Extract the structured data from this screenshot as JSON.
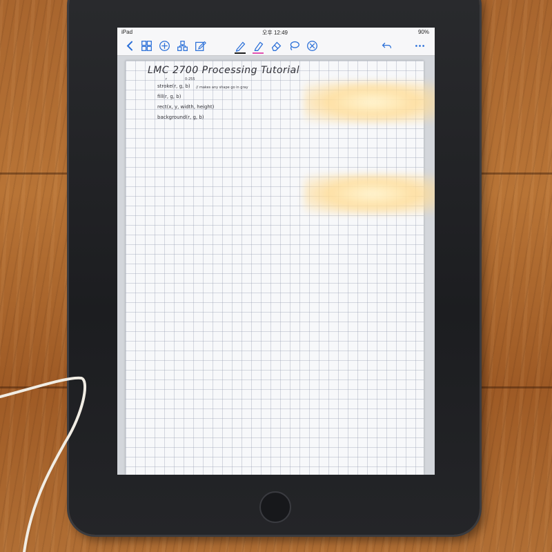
{
  "status_bar": {
    "device": "iPad",
    "time": "오후 12:49",
    "battery": "90%"
  },
  "toolbar": {
    "icons": {
      "back": "chevron-left-icon",
      "grid": "grid-icon",
      "add": "plus-circle-icon",
      "shapes": "shapes-icon",
      "edit": "edit-icon",
      "pen": "pen-icon",
      "highlighter": "highlighter-icon",
      "eraser": "eraser-icon",
      "lasso": "lasso-icon",
      "close": "close-circle-icon",
      "undo": "undo-icon",
      "more": "more-icon"
    },
    "pen_color": "#1b1b1b",
    "highlighter_color": "#e050b0",
    "accent": "#2a6fd8"
  },
  "note": {
    "title": "LMC 2700  Processing  Tutorial",
    "annotations": {
      "red": "r",
      "range": "0-255"
    },
    "lines": [
      "stroke(r, g, b)",
      "fill(r, g, b)",
      "rect(x, y, width, height)",
      "background(r, g, b)"
    ],
    "note_side": "// makes any shape go in gray"
  }
}
